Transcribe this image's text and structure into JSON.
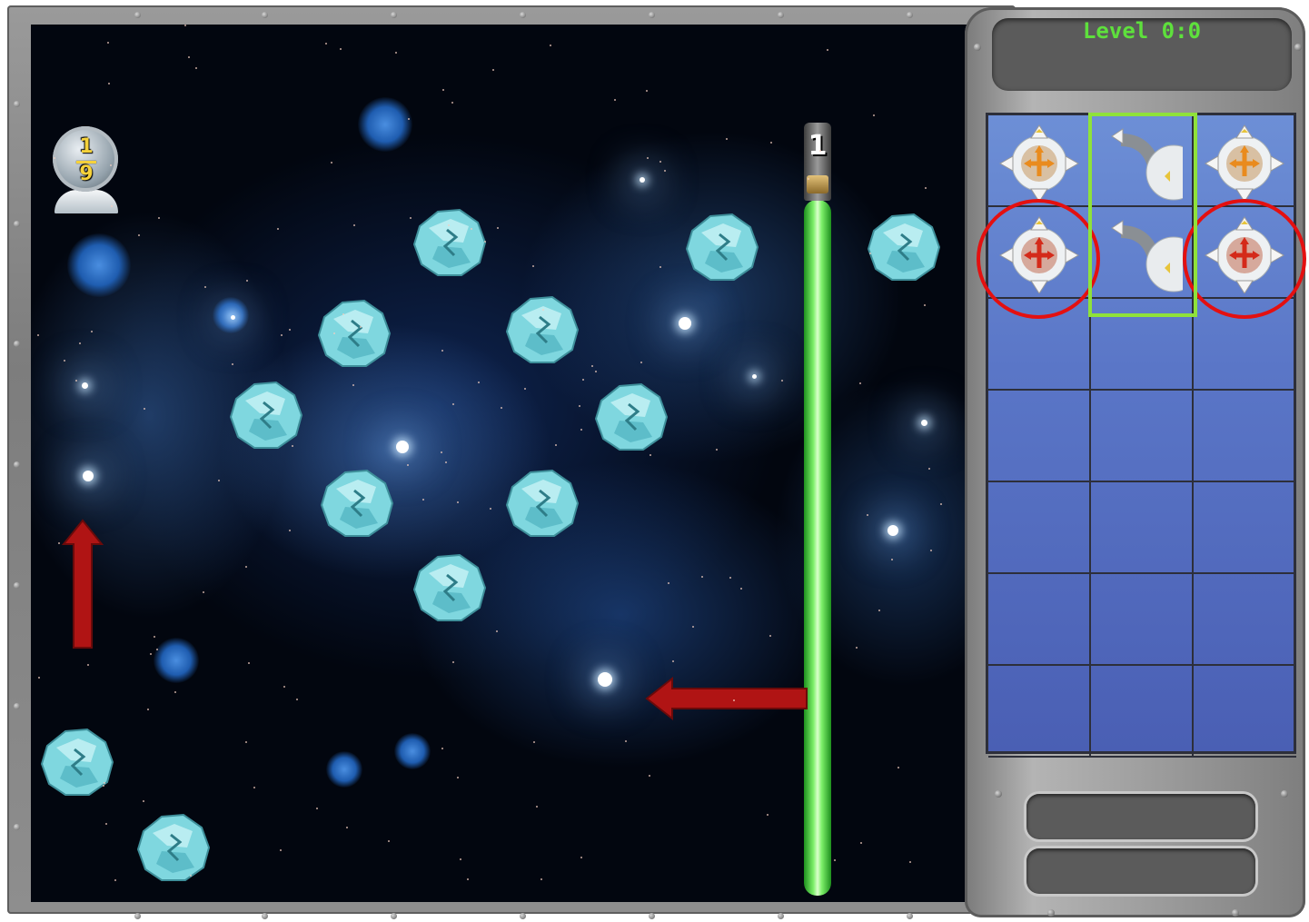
{
  "hud": {
    "level_label": "Level 0:0",
    "fraction_numerator": "1",
    "fraction_denominator": "9",
    "beam_counter": "1"
  },
  "colors": {
    "level_text": "#5ee03c",
    "beam": "#7ef06a",
    "grid_bg": "#5a76c7",
    "highlight_circle": "#e41010",
    "highlight_rect": "#8fe23a",
    "arrow": "#b01414"
  },
  "palette": {
    "columns": 3,
    "rows": 7,
    "pieces": [
      {
        "row": 0,
        "col": 0,
        "type": "splitter",
        "icon": "orange-turn-splitter-icon"
      },
      {
        "row": 0,
        "col": 1,
        "type": "pipe-bend",
        "icon": "pipe-bend-icon"
      },
      {
        "row": 0,
        "col": 2,
        "type": "splitter",
        "icon": "orange-fork-splitter-icon"
      },
      {
        "row": 1,
        "col": 0,
        "type": "splitter",
        "icon": "red-cross-splitter-icon",
        "highlight": "circle"
      },
      {
        "row": 1,
        "col": 1,
        "type": "pipe-bend",
        "icon": "pipe-bend-icon"
      },
      {
        "row": 1,
        "col": 2,
        "type": "splitter",
        "icon": "red-fork-splitter-icon",
        "highlight": "circle"
      }
    ],
    "highlighted_column": 1
  },
  "playfield": {
    "asteroid_count": 13,
    "arrows": [
      "up",
      "left"
    ]
  }
}
